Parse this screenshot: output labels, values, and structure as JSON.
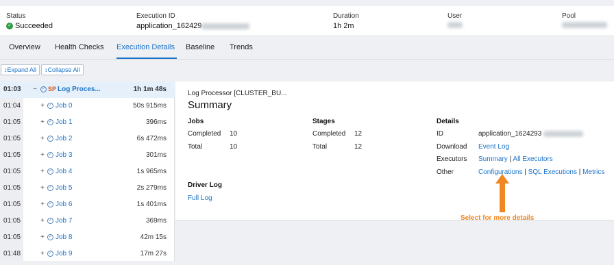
{
  "header": {
    "status_label": "Status",
    "status_value": "Succeeded",
    "exec_label": "Execution ID",
    "exec_value": "application_162429",
    "duration_label": "Duration",
    "duration_value": "1h 2m",
    "user_label": "User",
    "pool_label": "Pool"
  },
  "tabs": [
    "Overview",
    "Health Checks",
    "Execution Details",
    "Baseline",
    "Trends"
  ],
  "active_tab": "Execution Details",
  "toolbar": {
    "expand_label": "Expand All",
    "collapse_label": "Collapse All"
  },
  "tree": {
    "root": {
      "time": "01:03",
      "badge": "SP",
      "name": "Log Proces...",
      "duration": "1h 1m 48s"
    },
    "jobs": [
      {
        "time": "01:04",
        "name": "Job 0",
        "duration": "50s 915ms"
      },
      {
        "time": "01:05",
        "name": "Job 1",
        "duration": "396ms"
      },
      {
        "time": "01:05",
        "name": "Job 2",
        "duration": "6s 472ms"
      },
      {
        "time": "01:05",
        "name": "Job 3",
        "duration": "301ms"
      },
      {
        "time": "01:05",
        "name": "Job 4",
        "duration": "1s 965ms"
      },
      {
        "time": "01:05",
        "name": "Job 5",
        "duration": "2s 279ms"
      },
      {
        "time": "01:05",
        "name": "Job 6",
        "duration": "1s 401ms"
      },
      {
        "time": "01:05",
        "name": "Job 7",
        "duration": "369ms"
      },
      {
        "time": "01:05",
        "name": "Job 8",
        "duration": "42m 15s"
      },
      {
        "time": "01:48",
        "name": "Job 9",
        "duration": "17m 27s"
      }
    ]
  },
  "summary": {
    "subtitle": "Log Processor [CLUSTER_BU...",
    "title": "Summary",
    "jobs": {
      "heading": "Jobs",
      "completed_label": "Completed",
      "completed": "10",
      "total_label": "Total",
      "total": "10"
    },
    "stages": {
      "heading": "Stages",
      "completed_label": "Completed",
      "completed": "12",
      "total_label": "Total",
      "total": "12"
    },
    "details": {
      "heading": "Details",
      "id_label": "ID",
      "id_value": "application_1624293",
      "download_label": "Download",
      "download_link": "Event Log",
      "executors_label": "Executors",
      "executors_link1": "Summary",
      "executors_link2": "All Executors",
      "other_label": "Other",
      "other_link1": "Configurations",
      "other_link2": "SQL Executions",
      "other_link3": "Metrics",
      "separator": "|"
    },
    "driver_heading": "Driver Log",
    "driver_link": "Full Log"
  },
  "callout": "Select for more details",
  "colors": {
    "accent": "#1a73c9",
    "success": "#2e9e44",
    "callout": "#f08722",
    "sp_badge": "#d7561a"
  }
}
